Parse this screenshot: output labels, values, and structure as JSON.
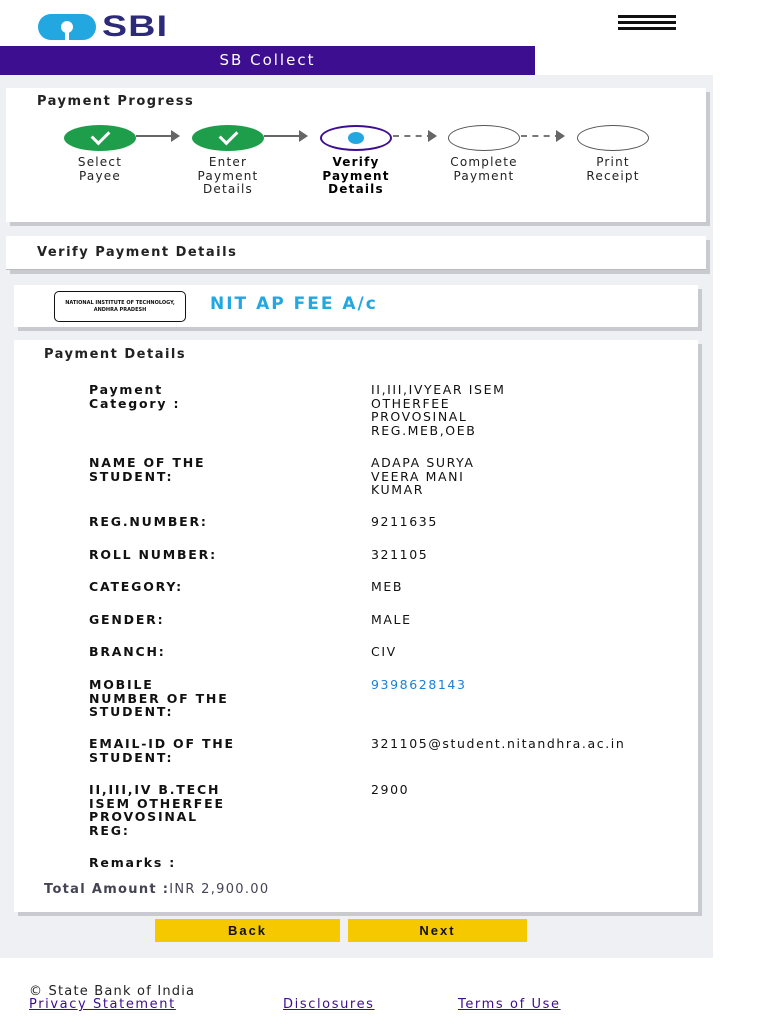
{
  "header": {
    "brand": "SBI",
    "title": "SB Collect"
  },
  "progress": {
    "heading": "Payment Progress",
    "steps": [
      {
        "label": "Select\nPayee",
        "state": "done"
      },
      {
        "label": "Enter\nPayment\nDetails",
        "state": "done"
      },
      {
        "label": "Verify\nPayment\nDetails",
        "state": "current"
      },
      {
        "label": "Complete\nPayment",
        "state": "pending"
      },
      {
        "label": "Print\nReceipt",
        "state": "pending"
      }
    ]
  },
  "verify": {
    "heading": "Verify Payment Details"
  },
  "payee": {
    "logo_text": "NATIONAL INSTITUTE OF TECHNOLOGY,\nANDHRA PRADESH",
    "name": "NIT AP FEE A/c"
  },
  "details": {
    "heading": "Payment Details",
    "rows": [
      {
        "label": "Payment\nCategory :",
        "value": "II,III,IVYEAR ISEM\nOTHERFEE\nPROVOSINAL\nREG.MEB,OEB"
      },
      {
        "label": "NAME OF THE\nSTUDENT:",
        "value": "ADAPA SURYA\nVEERA MANI\nKUMAR"
      },
      {
        "label": "REG.NUMBER:",
        "value": "9211635"
      },
      {
        "label": "ROLL NUMBER:",
        "value": "321105"
      },
      {
        "label": "CATEGORY:",
        "value": "MEB"
      },
      {
        "label": "GENDER:",
        "value": "MALE"
      },
      {
        "label": "BRANCH:",
        "value": "CIV"
      },
      {
        "label": "MOBILE\nNUMBER OF THE\nSTUDENT:",
        "value": "9398628143"
      },
      {
        "label": "EMAIL-ID OF THE\nSTUDENT:",
        "value": "321105@student.nitandhra.ac.in"
      },
      {
        "label": "II,III,IV B.TECH\nISEM OTHERFEE\nPROVOSINAL\nREG:",
        "value": "2900"
      },
      {
        "label": "Remarks :",
        "value": ""
      }
    ],
    "total_label": "Total Amount :",
    "total_value": "INR 2,900.00"
  },
  "buttons": {
    "back": "Back",
    "next": "Next"
  },
  "footer": {
    "copyright": "© State Bank of India",
    "links": [
      "Privacy Statement",
      "Disclosures",
      "Terms of Use"
    ]
  },
  "colors": {
    "brand_purple": "#3d0e8f",
    "brand_blue": "#22a7e0",
    "done_green": "#1e9e4a",
    "button_yellow": "#f5c800",
    "link_blue": "#1b7fd4"
  },
  "icons": [
    "sbi-logo-icon",
    "hamburger-menu-icon",
    "check-icon"
  ]
}
